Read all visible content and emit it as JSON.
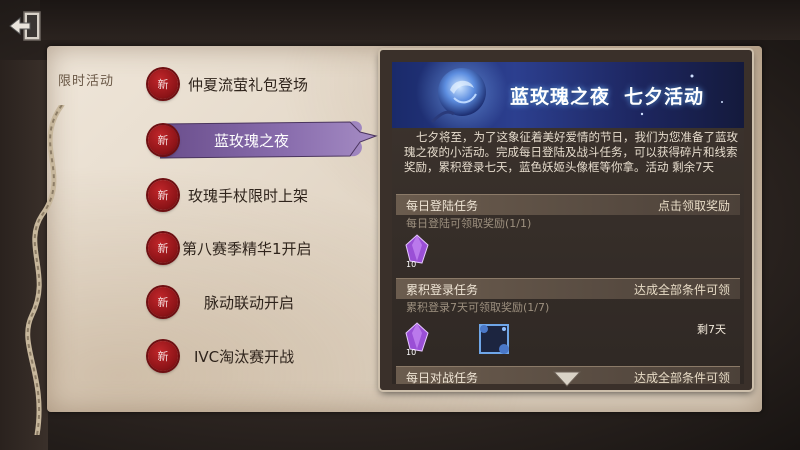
{
  "side_label": "限时活动",
  "tabs": [
    {
      "seal": "新",
      "label": "仲夏流萤礼包登场"
    },
    {
      "seal": "新",
      "label": "蓝玫瑰之夜",
      "active": true
    },
    {
      "seal": "新",
      "label": "玫瑰手杖限时上架"
    },
    {
      "seal": "新",
      "label": "第八赛季精华1开启"
    },
    {
      "seal": "新",
      "label": "脉动联动开启"
    },
    {
      "seal": "新",
      "label": "IVC淘汰赛开战"
    }
  ],
  "event": {
    "banner_title": "蓝玫瑰之夜",
    "banner_subtitle": "七夕活动",
    "description": "七夕将至，为了这象征着美好爱情的节日，我们为您准备了蓝玫瑰之夜的小活动。完成每日登陆及战斗任务，可以获得碎片和线索奖励，累积登录七天，蓝色妖姬头像框等你拿。活动 剩余7天"
  },
  "tasks": [
    {
      "title": "每日登陆任务",
      "action": "点击领取奖励",
      "subtitle": "每日登陆可领取奖励(1/1)",
      "items": [
        {
          "icon": "purple-crystal-icon",
          "count": "10"
        }
      ]
    },
    {
      "title": "累积登录任务",
      "action": "达成全部条件可领",
      "subtitle": "累积登录7天可领取奖励(1/7)",
      "remaining": "剩7天",
      "items": [
        {
          "icon": "purple-crystal-icon",
          "count": "10"
        },
        {
          "icon": "blue-rose-frame-icon",
          "count": ""
        }
      ]
    },
    {
      "title": "每日对战任务",
      "action": "达成全部条件可领"
    }
  ],
  "colors": {
    "seal_red": "#9b1a1e",
    "ribbon_purple": "#7c5f9e",
    "banner_blue": "#2c3f8f",
    "crystal_purple": "#9a4fd6"
  }
}
